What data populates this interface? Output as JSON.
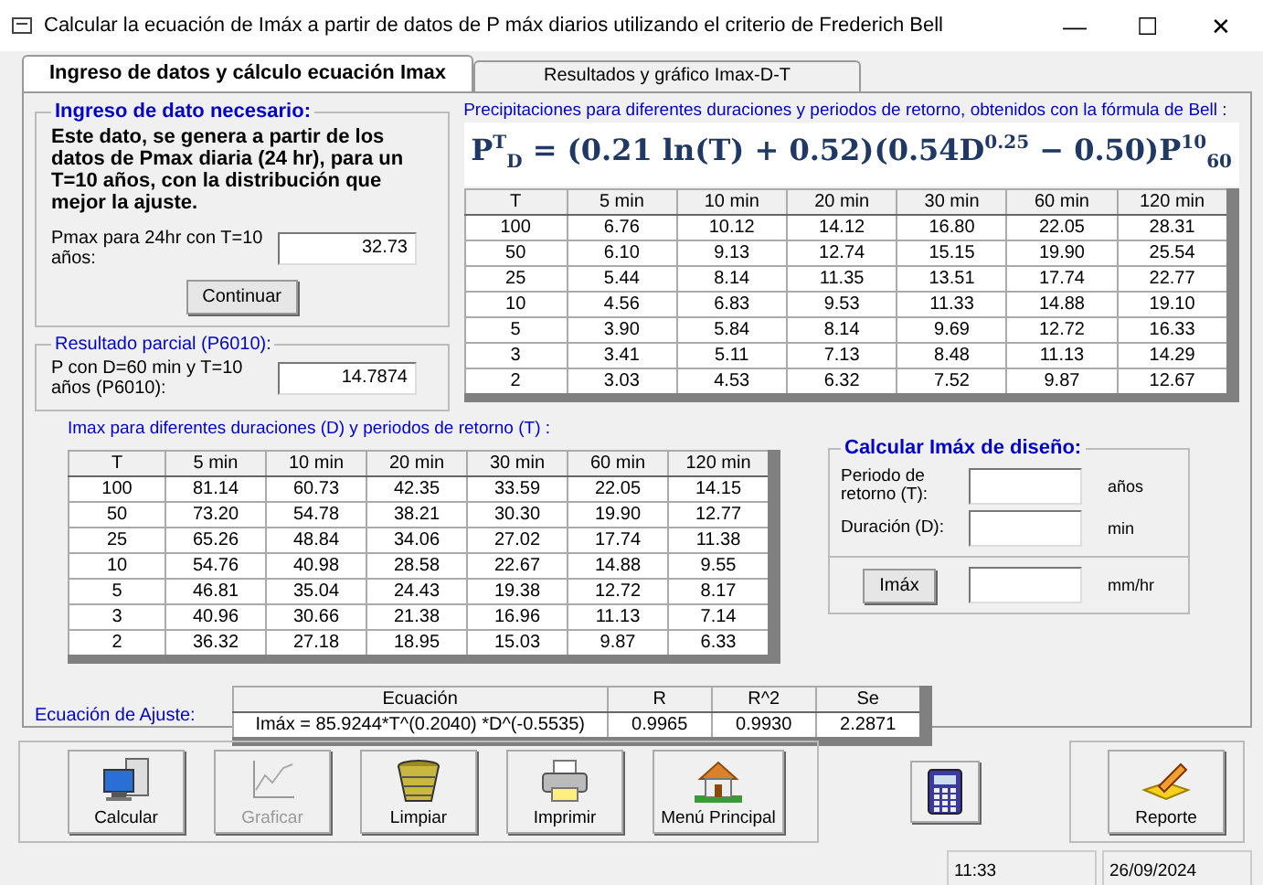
{
  "window": {
    "title": "Calcular la ecuación de Imáx a partir de datos de P máx diarios utilizando el criterio de Frederich Bell",
    "controls": [
      "—",
      "☐",
      "✕"
    ]
  },
  "tabs": [
    {
      "label": "Ingreso de datos y cálculo ecuación Imax",
      "selected": true
    },
    {
      "label": "Resultados y gráfico Imax-D-T",
      "selected": false
    }
  ],
  "input_group": {
    "title": "Ingreso de dato necesario:",
    "description": "Este dato, se genera a partir de los datos de Pmax diaria (24 hr), para un T=10 años, con la distribución que mejor la ajuste.",
    "field_label": "Pmax para 24hr con T=10 años:",
    "value": "32.73",
    "button": "Continuar"
  },
  "partial_result": {
    "title": "Resultado parcial (P6010):",
    "field_label": "P con D=60 min y T=10 años (P6010):",
    "value": "14.7874"
  },
  "precipitation": {
    "caption": "Precipitaciones para diferentes duraciones y periodos de retorno, obtenidos con la fórmula de Bell :",
    "formula": "P$^{T}$$_{D}$ = (0.21 ln(T) + 0.52)(0.54D$^{0.25}$ − 0.50)P$^{10}$$_{60}$",
    "columns": [
      "T",
      "5 min",
      "10 min",
      "20 min",
      "30 min",
      "60 min",
      "120 min"
    ],
    "rows": [
      [
        "100",
        "6.76",
        "10.12",
        "14.12",
        "16.80",
        "22.05",
        "28.31"
      ],
      [
        "50",
        "6.10",
        "9.13",
        "12.74",
        "15.15",
        "19.90",
        "25.54"
      ],
      [
        "25",
        "5.44",
        "8.14",
        "11.35",
        "13.51",
        "17.74",
        "22.77"
      ],
      [
        "10",
        "4.56",
        "6.83",
        "9.53",
        "11.33",
        "14.88",
        "19.10"
      ],
      [
        "5",
        "3.90",
        "5.84",
        "8.14",
        "9.69",
        "12.72",
        "16.33"
      ],
      [
        "3",
        "3.41",
        "5.11",
        "7.13",
        "8.48",
        "11.13",
        "14.29"
      ],
      [
        "2",
        "3.03",
        "4.53",
        "6.32",
        "7.52",
        "9.87",
        "12.67"
      ]
    ]
  },
  "imax": {
    "caption": "Imax para diferentes duraciones (D) y periodos de retorno (T) :",
    "columns": [
      "T",
      "5 min",
      "10 min",
      "20 min",
      "30 min",
      "60 min",
      "120 min"
    ],
    "rows": [
      [
        "100",
        "81.14",
        "60.73",
        "42.35",
        "33.59",
        "22.05",
        "14.15"
      ],
      [
        "50",
        "73.20",
        "54.78",
        "38.21",
        "30.30",
        "19.90",
        "12.77"
      ],
      [
        "25",
        "65.26",
        "48.84",
        "34.06",
        "27.02",
        "17.74",
        "11.38"
      ],
      [
        "10",
        "54.76",
        "40.98",
        "28.58",
        "22.67",
        "14.88",
        "9.55"
      ],
      [
        "5",
        "46.81",
        "35.04",
        "24.43",
        "19.38",
        "12.72",
        "8.17"
      ],
      [
        "3",
        "40.96",
        "30.66",
        "21.38",
        "16.96",
        "11.13",
        "7.14"
      ],
      [
        "2",
        "36.32",
        "27.18",
        "18.95",
        "15.03",
        "9.87",
        "6.33"
      ]
    ]
  },
  "design": {
    "title": "Calcular Imáx de diseño:",
    "period_label": "Periodo de retorno (T):",
    "period_unit": "años",
    "duration_label": "Duración (D):",
    "duration_unit": "min",
    "button": "Imáx",
    "result_unit": "mm/hr"
  },
  "fit": {
    "label": "Ecuación de Ajuste:",
    "columns": [
      "Ecuación",
      "R",
      "R^2",
      "Se"
    ],
    "rows": [
      [
        "Imáx = 85.9244*T^(0.2040) *D^(-0.5535)",
        "0.9965",
        "0.9930",
        "2.2871"
      ]
    ]
  },
  "toolbar": [
    {
      "label": "Calcular",
      "kind": "computer",
      "disabled": false
    },
    {
      "label": "Graficar",
      "kind": "chart",
      "disabled": true
    },
    {
      "label": "Limpiar",
      "kind": "basket",
      "disabled": false
    },
    {
      "label": "Imprimir",
      "kind": "printer",
      "disabled": false
    },
    {
      "label": "Menú Principal",
      "kind": "house",
      "disabled": false
    }
  ],
  "report": {
    "label": "Reporte"
  },
  "status_bar": {
    "time": "11:33",
    "date": "26/09/2024"
  }
}
